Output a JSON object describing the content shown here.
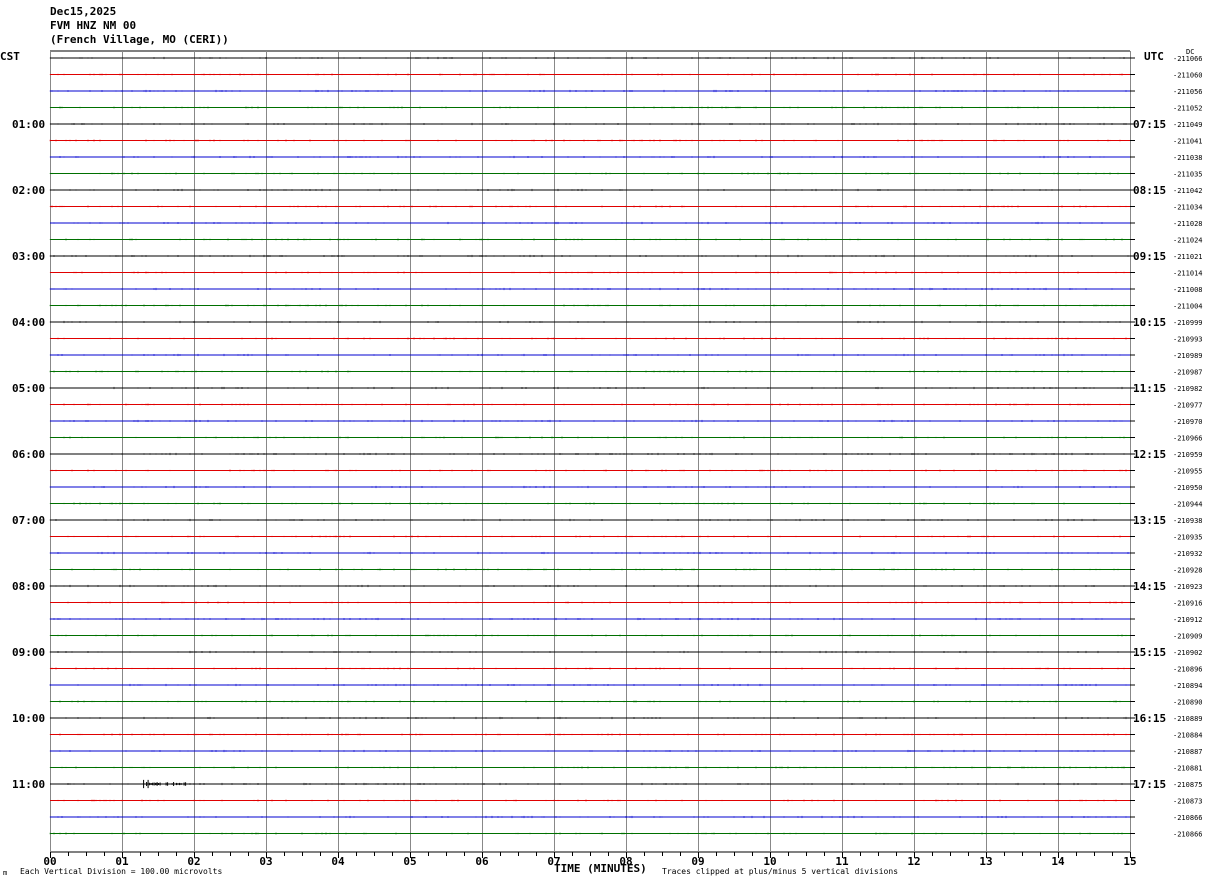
{
  "header": {
    "date": "Dec15,2025",
    "station": "FVM HNZ NM 00",
    "location": "(French Village, MO (CERI))"
  },
  "axis": {
    "left_tz": "CST",
    "right_tz": "UTC",
    "dc_label": "DC",
    "xlabel": "TIME (MINUTES)",
    "left_note": "Each Vertical Division =  100.00 microvolts",
    "right_note": "Traces clipped at plus/minus 5 vertical divisions",
    "corner_mark": "m"
  },
  "colors": {
    "cycle": [
      "#000000",
      "#e00000",
      "#0000d0",
      "#007000"
    ],
    "grid": "#888888"
  },
  "chart_data": {
    "type": "line",
    "x_ticks": [
      "00",
      "01",
      "02",
      "03",
      "04",
      "05",
      "06",
      "07",
      "08",
      "09",
      "10",
      "11",
      "12",
      "13",
      "14",
      "15"
    ],
    "xlim": [
      0,
      15
    ],
    "minor_tick_step": 0.25,
    "trace_count": 48,
    "hour_labels_cst": [
      "01:00",
      "02:00",
      "03:00",
      "04:00",
      "05:00",
      "06:00",
      "07:00",
      "08:00",
      "09:00",
      "10:00",
      "11:00"
    ],
    "hour_labels_utc": [
      "07:15",
      "08:15",
      "09:15",
      "10:15",
      "11:15",
      "12:15",
      "13:15",
      "14:15",
      "15:15",
      "16:15",
      "17:15"
    ],
    "dc_offsets": [
      "-211066",
      "-211060",
      "-211056",
      "-211052",
      "-211049",
      "-211041",
      "-211038",
      "-211035",
      "-211042",
      "-211034",
      "-211028",
      "-211024",
      "-211021",
      "-211014",
      "-211008",
      "-211004",
      "-210999",
      "-210993",
      "-210989",
      "-210987",
      "-210982",
      "-210977",
      "-210970",
      "-210966",
      "-210959",
      "-210955",
      "-210950",
      "-210944",
      "-210938",
      "-210935",
      "-210932",
      "-210928",
      "-210923",
      "-210916",
      "-210912",
      "-210909",
      "-210902",
      "-210896",
      "-210894",
      "-210890",
      "-210889",
      "-210884",
      "-210887",
      "-210881",
      "-210875",
      "-210873",
      "-210866",
      "-210866"
    ],
    "event": {
      "trace_index": 44,
      "start_min": 1.3,
      "end_min": 1.9
    }
  }
}
